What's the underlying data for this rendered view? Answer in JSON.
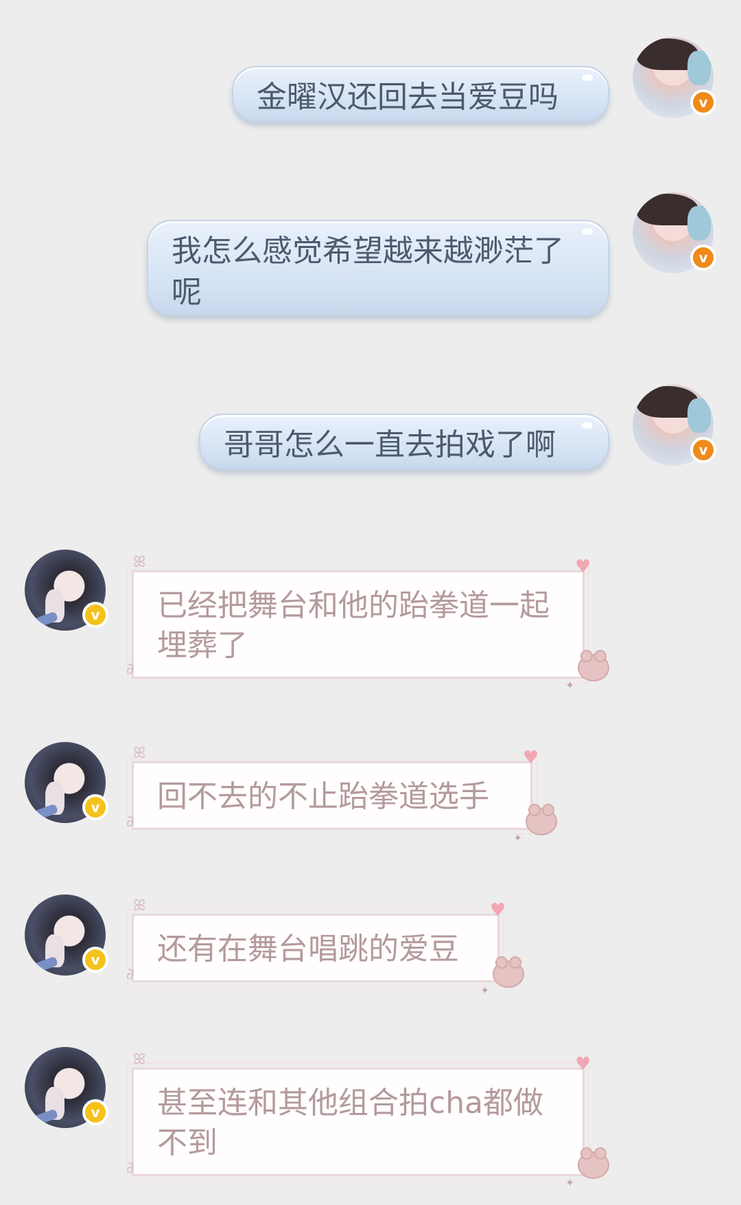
{
  "conversation": {
    "messages": [
      {
        "side": "sent",
        "text": "金曜汉还回去当爱豆吗"
      },
      {
        "side": "sent",
        "text": "我怎么感觉希望越来越渺茫了呢"
      },
      {
        "side": "sent",
        "text": "哥哥怎么一直去拍戏了啊"
      },
      {
        "side": "received",
        "text": "已经把舞台和他的跆拳道一起埋葬了"
      },
      {
        "side": "received",
        "text": "回不去的不止跆拳道选手"
      },
      {
        "side": "received",
        "text": "还有在舞台唱跳的爱豆"
      },
      {
        "side": "received",
        "text": "甚至连和其他组合拍cha都做不到"
      }
    ],
    "badge_letter": "v"
  },
  "colors": {
    "background": "#ededed",
    "sent_text": "#4d5a6e",
    "received_text": "#b49a9c",
    "badge_self": "#f08a19",
    "badge_other": "#f4c21a"
  },
  "icons": {
    "heart": "♥",
    "bow": "ꕤ",
    "star": "✦",
    "clip": "∂"
  }
}
